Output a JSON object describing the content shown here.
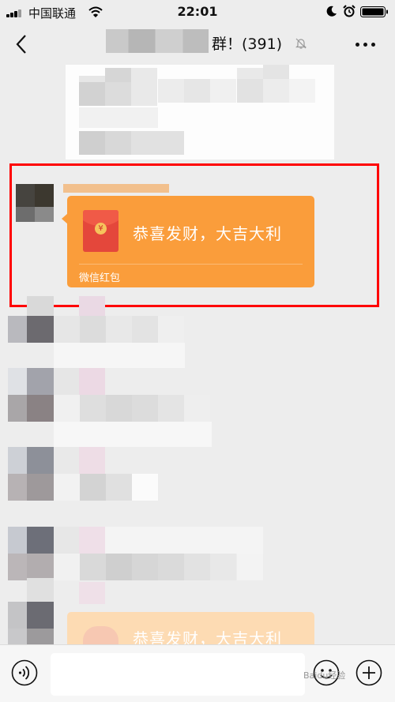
{
  "status_bar": {
    "carrier": "中国联通",
    "time": "22:01",
    "icons": [
      "signal-icon",
      "wifi-icon",
      "moon-icon",
      "alarm-icon",
      "battery-icon"
    ]
  },
  "nav": {
    "back_icon": "back-chevron-icon",
    "title": "群！(391)",
    "mute_icon": "mute-bell-icon",
    "more_icon": "more-dots-icon"
  },
  "red_packet": {
    "message": "恭喜发财，大吉大利",
    "footer": "微信红包",
    "coin_symbol": "¥",
    "color": "#fa9d3b"
  },
  "red_packet_2": {
    "message": "恭喜发财，大吉大利"
  },
  "highlight": {
    "color": "#ff0000"
  },
  "input_bar": {
    "icons": [
      "voice-icon",
      "emoji-icon",
      "plus-icon"
    ],
    "value": "",
    "watermark": "Baidu经验"
  }
}
